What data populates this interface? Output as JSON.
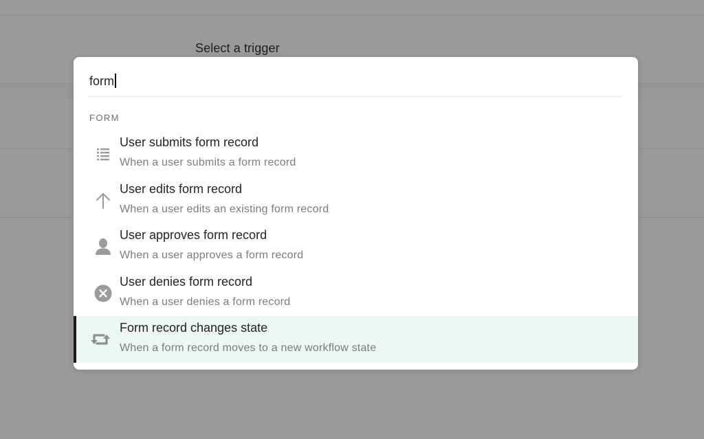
{
  "background": {
    "heading": "Select a trigger"
  },
  "modal": {
    "search": {
      "value": "form",
      "placeholder": ""
    },
    "section_label": "FORM",
    "items": [
      {
        "icon": "list-icon",
        "title": "User submits form record",
        "subtitle": "When a user submits a form record",
        "selected": false
      },
      {
        "icon": "arrow-up-icon",
        "title": "User edits form record",
        "subtitle": "When a user edits an existing form record",
        "selected": false
      },
      {
        "icon": "user-icon",
        "title": "User approves form record",
        "subtitle": "When a user approves a form record",
        "selected": false
      },
      {
        "icon": "close-circle-icon",
        "title": "User denies form record",
        "subtitle": "When a user denies a form record",
        "selected": false
      },
      {
        "icon": "repeat-icon",
        "title": "Form record changes state",
        "subtitle": "When a form record moves to a new workflow state",
        "selected": true
      }
    ]
  },
  "colors": {
    "overlay": "#9a9a9a",
    "selected_row": "#eef5f5",
    "selected_marker": "#1a1a1a",
    "icon": "#9b9b9b"
  }
}
